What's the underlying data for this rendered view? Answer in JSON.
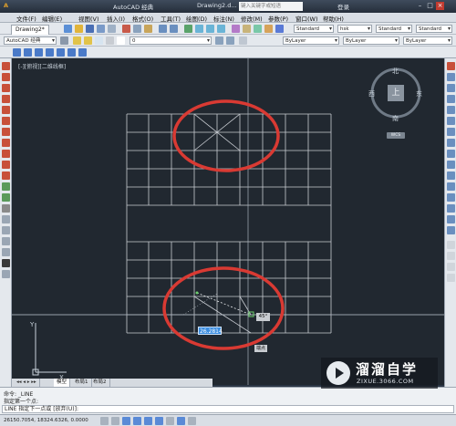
{
  "window": {
    "app_title": "AutoCAD 经典",
    "doc_title": "Drawing2.d...",
    "search_placeholder": "键入关键字或短语",
    "login": "登录",
    "min": "–",
    "max": "□",
    "close": "×"
  },
  "menu": [
    "文件(F)",
    "编辑(E)",
    "视图(V)",
    "插入(I)",
    "格式(O)",
    "工具(T)",
    "绘图(D)",
    "标注(N)",
    "修改(M)",
    "参数(P)",
    "窗口(W)",
    "帮助(H)"
  ],
  "toolbar": {
    "tab_label": "Drawing2*",
    "text_style": "Standard",
    "dim_style": "hsk",
    "table_style": "Standard",
    "workspace": "AutoCAD 经典",
    "layer": "0",
    "color": "ByLayer",
    "linetype": "ByLayer",
    "lineweight": "ByLayer"
  },
  "canvas": {
    "view_label": "[-][俯视][二维线框]",
    "compass": {
      "n": "北",
      "s": "南",
      "e": "东",
      "w": "西",
      "top": "上",
      "wcs": "WCS"
    },
    "dynamic_input": "26.2814",
    "angle_tip": "45°",
    "snap_tip": "端点"
  },
  "layout_tabs": [
    "模型",
    "布局1",
    "布局2"
  ],
  "command": {
    "line1": "命令:  _LINE",
    "line2": "指定第一个点:",
    "prompt": "LINE 指定下一点或 [放弃(U)]:"
  },
  "status": {
    "coords": "26150.7054, 18324.6326, 0.0000"
  },
  "watermark": {
    "title": "溜溜自学",
    "url": "ZIXUE.3066.COM"
  },
  "colors": {
    "canvas": "#212830",
    "grid_line": "#c8ccd2",
    "highlight_ellipse": "#d93a33",
    "accent_blue": "#3b8de0"
  }
}
